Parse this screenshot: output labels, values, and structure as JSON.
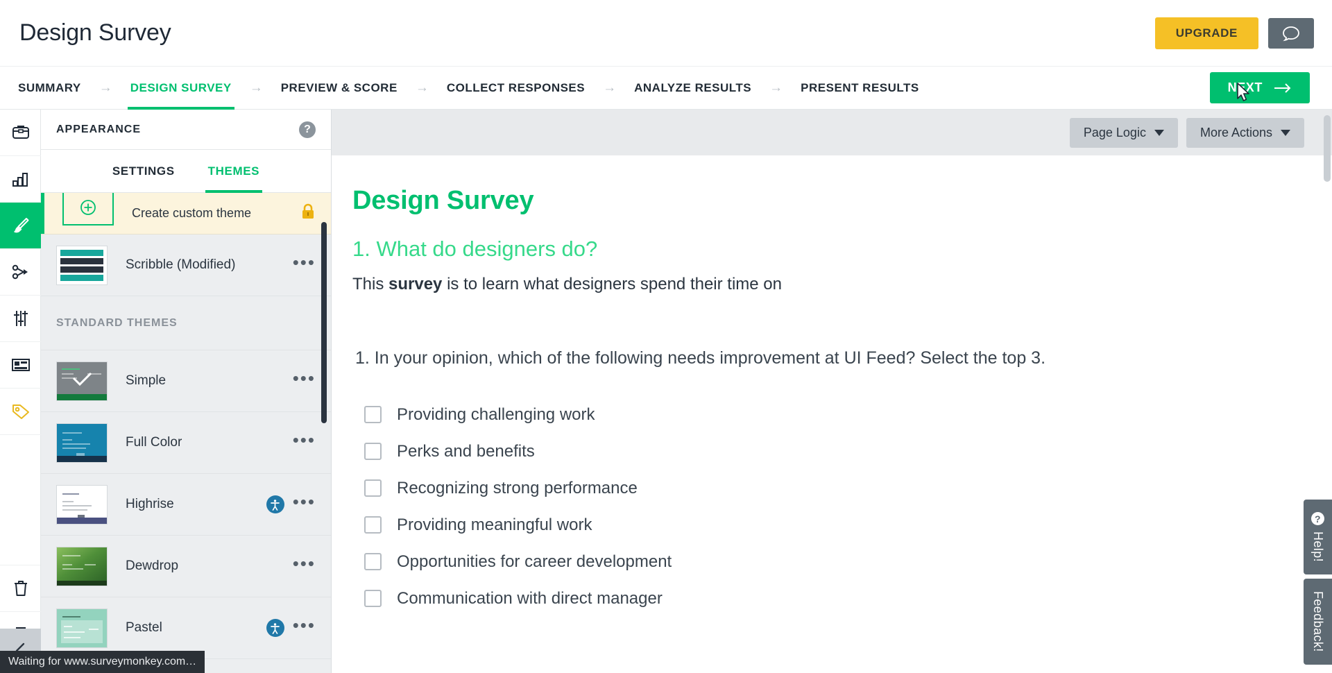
{
  "header": {
    "app_title": "Design Survey",
    "upgrade_label": "UPGRADE",
    "chat_icon": "speech-bubble-icon"
  },
  "nav": {
    "items": [
      {
        "label": "SUMMARY",
        "active": false
      },
      {
        "label": "DESIGN SURVEY",
        "active": true
      },
      {
        "label": "PREVIEW & SCORE",
        "active": false
      },
      {
        "label": "COLLECT RESPONSES",
        "active": false
      },
      {
        "label": "ANALYZE RESULTS",
        "active": false
      },
      {
        "label": "PRESENT RESULTS",
        "active": false
      }
    ],
    "separator": "→",
    "next_label": "NEXT",
    "next_icon": "arrow-right-icon"
  },
  "rail": {
    "items": [
      {
        "icon": "toolbox-icon",
        "active": false
      },
      {
        "icon": "bar-chart-icon",
        "active": false
      },
      {
        "icon": "paintbrush-icon",
        "active": true
      },
      {
        "icon": "logic-flow-icon",
        "active": false
      },
      {
        "icon": "sliders-icon",
        "active": false
      },
      {
        "icon": "layout-icon",
        "active": false
      },
      {
        "icon": "tag-icon",
        "active": false
      },
      {
        "icon": "trash-icon",
        "active": false
      },
      {
        "icon": "printer-icon",
        "active": false
      }
    ],
    "collapse_icon": "chevron-left-icon"
  },
  "panel": {
    "title": "APPEARANCE",
    "help_icon": "question-mark-icon",
    "tabs": [
      {
        "label": "SETTINGS",
        "active": false
      },
      {
        "label": "THEMES",
        "active": true
      }
    ],
    "create_theme": {
      "label": "Create custom theme",
      "plus_icon": "plus-circle-icon",
      "lock_icon": "lock-icon"
    },
    "custom_themes": [
      {
        "name": "Scribble (Modified)",
        "thumb": "scribble",
        "selected": false,
        "a11y": false,
        "menu": "•••"
      }
    ],
    "section_label": "STANDARD THEMES",
    "standard_themes": [
      {
        "name": "Simple",
        "thumb": "simple",
        "selected": true,
        "a11y": false,
        "menu": "•••"
      },
      {
        "name": "Full Color",
        "thumb": "full",
        "selected": false,
        "a11y": false,
        "menu": "•••"
      },
      {
        "name": "Highrise",
        "thumb": "high",
        "selected": false,
        "a11y": true,
        "menu": "•••"
      },
      {
        "name": "Dewdrop",
        "thumb": "dew",
        "selected": false,
        "a11y": false,
        "menu": "•••"
      },
      {
        "name": "Pastel",
        "thumb": "pastel",
        "selected": false,
        "a11y": true,
        "menu": "•••"
      }
    ]
  },
  "canvas": {
    "toolbar": {
      "page_logic_label": "Page Logic",
      "more_actions_label": "More Actions"
    },
    "survey_title": "Design Survey",
    "page_title": "1. What do designers do?",
    "page_desc_pre": "This ",
    "page_desc_bold": "survey",
    "page_desc_post": " is to learn what designers spend their time on",
    "question": "1. In your opinion, which of the following needs improvement at UI Feed? Select the top 3.",
    "choices": [
      "Providing challenging work",
      "Perks and benefits",
      "Recognizing strong performance",
      "Providing meaningful work",
      "Opportunities for career development",
      "Communication with direct manager"
    ]
  },
  "side_tabs": [
    {
      "label": "Help!",
      "icon": "question-circle-icon"
    },
    {
      "label": "Feedback!",
      "icon": ""
    }
  ],
  "status_bar": {
    "text": "Waiting for www.surveymonkey.com…"
  },
  "colors": {
    "brand_green": "#00bf6f",
    "upgrade_yellow": "#f5c026",
    "dark_gray": "#5e6a73",
    "panel_bg": "#eceef0",
    "cream": "#fcf4dd"
  }
}
